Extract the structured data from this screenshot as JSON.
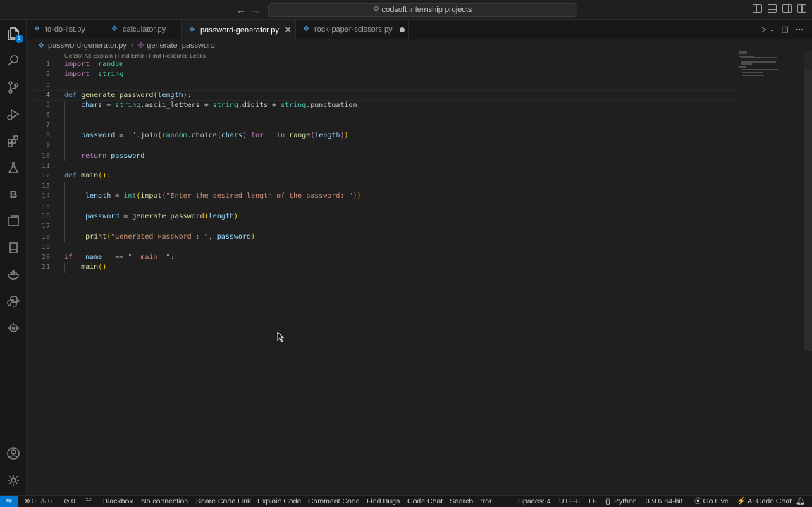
{
  "search": {
    "text": "codsoft internship projects"
  },
  "tabs": [
    {
      "label": "to-do-list.py",
      "active": false,
      "modified": false
    },
    {
      "label": "calculator.py",
      "active": false,
      "modified": false
    },
    {
      "label": "password-generator.py",
      "active": true,
      "modified": false
    },
    {
      "label": "rock-paper-scissors.py",
      "active": false,
      "modified": true
    }
  ],
  "activity": {
    "explorer_badge": "1",
    "blackbox_letter": "B"
  },
  "breadcrumb": {
    "file": "password-generator.py",
    "symbol": "generate_password"
  },
  "codelens": "GetBot AI: Explain | Find Error | Find Resource Leaks",
  "lines": [
    {
      "n": "1",
      "tokens": [
        [
          "kw",
          "import"
        ],
        [
          "",
          "  "
        ],
        [
          "bi",
          "random"
        ]
      ]
    },
    {
      "n": "2",
      "tokens": [
        [
          "kw",
          "import"
        ],
        [
          "",
          "  "
        ],
        [
          "bi",
          "string"
        ]
      ]
    },
    {
      "n": "3",
      "tokens": []
    },
    {
      "n": "4",
      "tokens": [
        [
          "kw2",
          "def"
        ],
        [
          "",
          " "
        ],
        [
          "fn",
          "generate_password"
        ],
        [
          "paren",
          "("
        ],
        [
          "var",
          "length"
        ],
        [
          "paren",
          ")"
        ],
        [
          "",
          ":"
        ]
      ]
    },
    {
      "n": "5",
      "tokens": [
        [
          "",
          "    "
        ],
        [
          "var",
          "chars"
        ],
        [
          "",
          " = "
        ],
        [
          "bi",
          "string"
        ],
        [
          "",
          ".ascii_letters + "
        ],
        [
          "bi",
          "string"
        ],
        [
          "",
          ".digits + "
        ],
        [
          "bi",
          "string"
        ],
        [
          "",
          ".punctuation"
        ]
      ]
    },
    {
      "n": "6",
      "tokens": []
    },
    {
      "n": "7",
      "tokens": []
    },
    {
      "n": "8",
      "tokens": [
        [
          "",
          "    "
        ],
        [
          "var",
          "password"
        ],
        [
          "",
          " = "
        ],
        [
          "str",
          "''"
        ],
        [
          "",
          ".join"
        ],
        [
          "paren",
          "("
        ],
        [
          "bi",
          "random"
        ],
        [
          "",
          ".choice"
        ],
        [
          "paren2",
          "("
        ],
        [
          "var",
          "chars"
        ],
        [
          "paren2",
          ")"
        ],
        [
          "",
          " "
        ],
        [
          "kw",
          "for"
        ],
        [
          "",
          " _ "
        ],
        [
          "kw",
          "in"
        ],
        [
          "",
          " "
        ],
        [
          "fn",
          "range"
        ],
        [
          "paren2",
          "("
        ],
        [
          "var",
          "length"
        ],
        [
          "paren2",
          ")"
        ],
        [
          "paren",
          ")"
        ]
      ]
    },
    {
      "n": "9",
      "tokens": []
    },
    {
      "n": "10",
      "tokens": [
        [
          "",
          "    "
        ],
        [
          "kw",
          "return"
        ],
        [
          "",
          " "
        ],
        [
          "var",
          "password"
        ]
      ]
    },
    {
      "n": "11",
      "tokens": []
    },
    {
      "n": "12",
      "tokens": [
        [
          "kw2",
          "def"
        ],
        [
          "",
          " "
        ],
        [
          "fn",
          "main"
        ],
        [
          "paren",
          "()"
        ],
        [
          "",
          ":"
        ]
      ]
    },
    {
      "n": "13",
      "tokens": []
    },
    {
      "n": "14",
      "tokens": [
        [
          "",
          "     "
        ],
        [
          "var",
          "length"
        ],
        [
          "",
          " = "
        ],
        [
          "bi",
          "int"
        ],
        [
          "paren",
          "("
        ],
        [
          "fn",
          "input"
        ],
        [
          "paren2",
          "("
        ],
        [
          "str",
          "\"Enter the desired length of the password: \""
        ],
        [
          "paren2",
          ")"
        ],
        [
          "paren",
          ")"
        ]
      ]
    },
    {
      "n": "15",
      "tokens": []
    },
    {
      "n": "16",
      "tokens": [
        [
          "",
          "     "
        ],
        [
          "var",
          "password"
        ],
        [
          "",
          " = "
        ],
        [
          "fn",
          "generate_password"
        ],
        [
          "paren",
          "("
        ],
        [
          "var",
          "length"
        ],
        [
          "paren",
          ")"
        ]
      ]
    },
    {
      "n": "17",
      "tokens": []
    },
    {
      "n": "18",
      "tokens": [
        [
          "",
          "     "
        ],
        [
          "fn",
          "print"
        ],
        [
          "paren",
          "("
        ],
        [
          "str",
          "\"Generated Password : \""
        ],
        [
          "",
          ", "
        ],
        [
          "var",
          "password"
        ],
        [
          "paren",
          ")"
        ]
      ]
    },
    {
      "n": "19",
      "tokens": []
    },
    {
      "n": "20",
      "tokens": [
        [
          "kw",
          "if"
        ],
        [
          "",
          " "
        ],
        [
          "var",
          "__name__"
        ],
        [
          "",
          " == "
        ],
        [
          "str",
          "\"__main__\""
        ],
        [
          "",
          ":"
        ]
      ]
    },
    {
      "n": "21",
      "tokens": [
        [
          "",
          "    "
        ],
        [
          "fn",
          "main"
        ],
        [
          "paren",
          "()"
        ]
      ]
    }
  ],
  "status": {
    "errors": "0",
    "warnings": "0",
    "ports": "0",
    "items": [
      "Blackbox",
      "No connection",
      "Share Code Link",
      "Explain Code",
      "Comment Code",
      "Find Bugs",
      "Code Chat",
      "Search Error"
    ],
    "spaces": "Spaces: 4",
    "encoding": "UTF-8",
    "eol": "LF",
    "language": "Python",
    "interpreter": "3.9.6 64-bit",
    "golive": "Go Live",
    "aichat": "AI Code Chat"
  }
}
